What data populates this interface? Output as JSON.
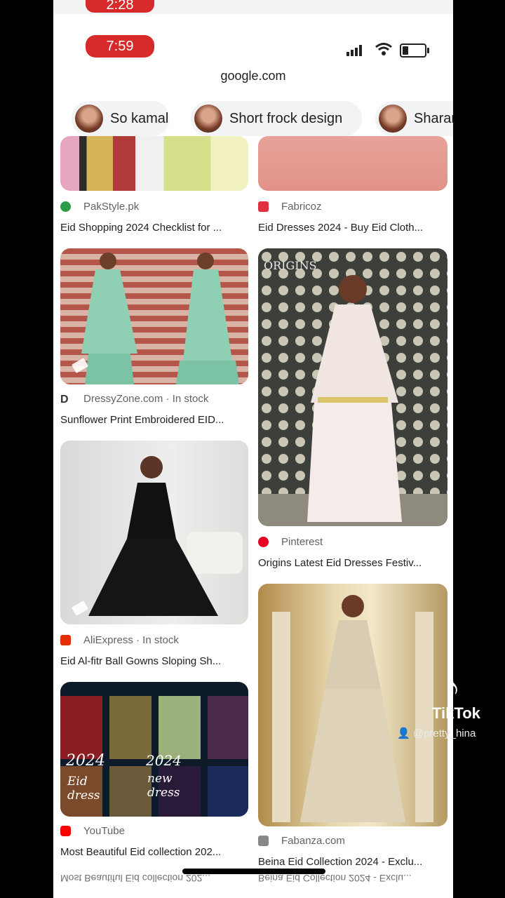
{
  "status": {
    "ghost_time": "2:28",
    "time": "7:59"
  },
  "browser": {
    "url": "google.com"
  },
  "chips": [
    {
      "label": "So kamal"
    },
    {
      "label": "Short frock design"
    },
    {
      "label": "Sharar"
    }
  ],
  "results": [
    {
      "source": "PakStyle.pk",
      "title": "Eid Shopping 2024 Checklist for ...",
      "icon_color": "#2e9b48"
    },
    {
      "source": "Fabricoz",
      "title": "Eid Dresses 2024 - Buy Eid Cloth...",
      "icon_color": "#e0323e"
    },
    {
      "source": "DressyZone.com · In stock",
      "title": "Sunflower Print Embroidered EID...",
      "icon_letter": "D"
    },
    {
      "source": "Pinterest",
      "title": "Origins Latest Eid Dresses Festiv...",
      "icon_color": "#e60023"
    },
    {
      "source": "AliExpress · In stock",
      "title": "Eid Al-fitr Ball Gowns Sloping Sh...",
      "icon_color": "#e62e04"
    },
    {
      "source": "YouTube",
      "title": "Most Beautiful Eid collection 202...",
      "icon_color": "#ff0000"
    },
    {
      "source": "Fabanza.com",
      "title": "Beina Eid Collection 2024 - Exclu...",
      "icon_color": "#888888"
    }
  ],
  "thumbnail_text": {
    "year": "2024",
    "line1": "Eid dress",
    "line2": "2024",
    "line3": "new dress"
  },
  "mirror_text": {
    "left": "Most Beautiful Eid collection 202...",
    "right": "Beina Eid Collection 2024 - Exclu..."
  },
  "overlay": {
    "app": "TikTok",
    "user": "@pretty_hina"
  },
  "colors": {
    "time_pill": "#d72a2a",
    "chip_bg": "#f1f3f4",
    "caption": "#202124",
    "source": "#5f6368"
  }
}
